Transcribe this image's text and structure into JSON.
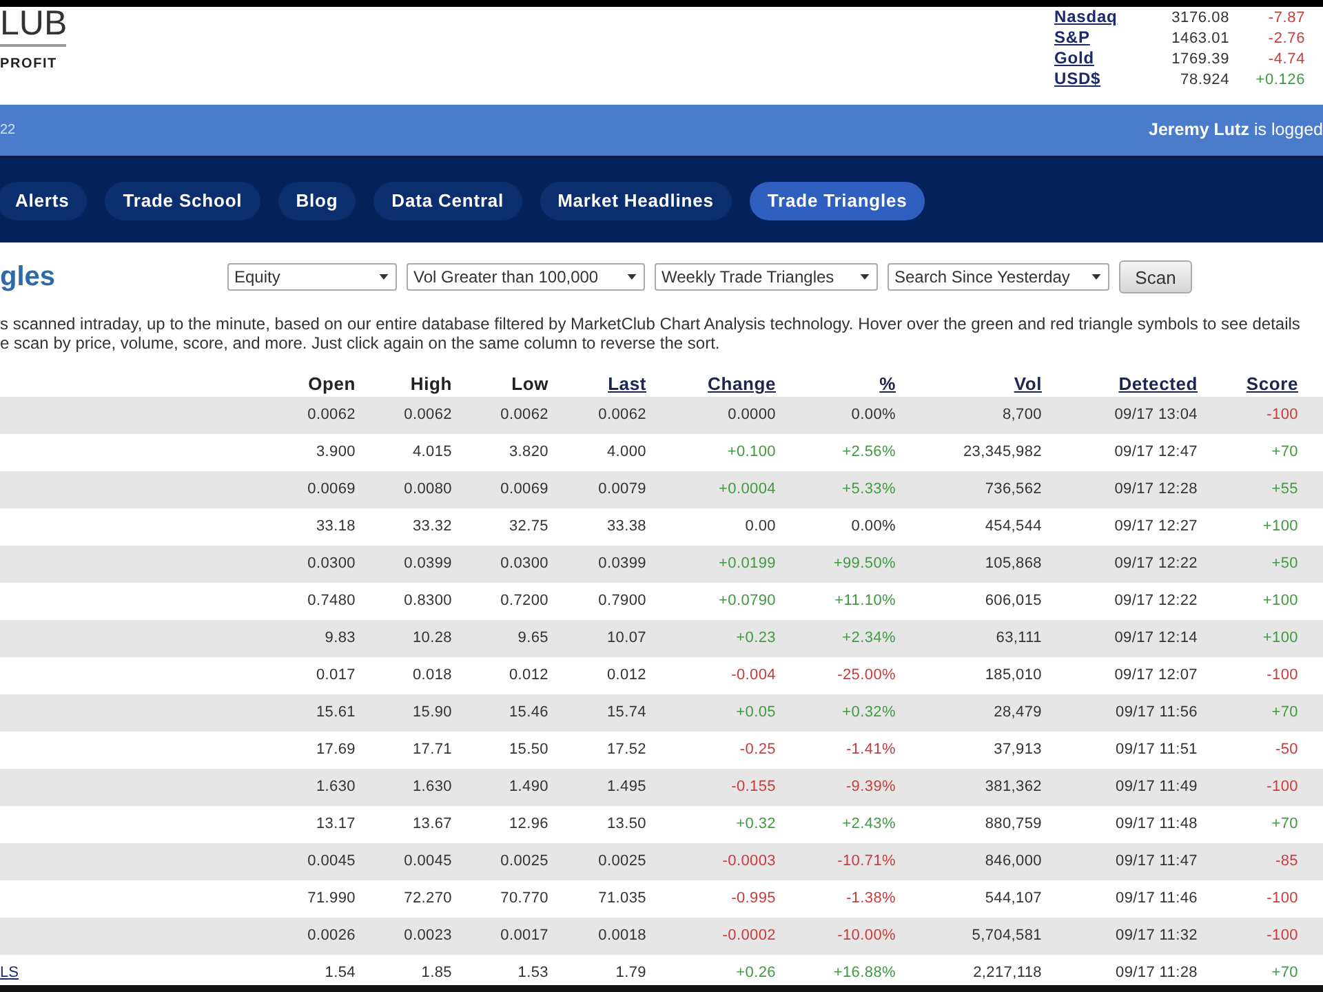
{
  "logo": {
    "wordmark": "LUB",
    "tagline": "PROFIT"
  },
  "market_ticker": [
    {
      "name": "Nasdaq",
      "value": "3176.08",
      "change": "-7.87",
      "color": "#cc3b3b"
    },
    {
      "name": "S&P",
      "value": "1463.01",
      "change": "-2.76",
      "color": "#cc3b3b"
    },
    {
      "name": "Gold",
      "value": "1769.39",
      "change": "-4.74",
      "color": "#cc3b3b"
    },
    {
      "name": "USD$",
      "value": "78.924",
      "change": "+0.126",
      "color": "#3f9b3f"
    }
  ],
  "user_bar": {
    "left_text": "22",
    "status": "**Jeremy Lutz** is logged"
  },
  "nav_tabs": [
    {
      "label": "Alerts",
      "selected": false
    },
    {
      "label": "Trade School",
      "selected": false
    },
    {
      "label": "Blog",
      "selected": false
    },
    {
      "label": "Data Central",
      "selected": false
    },
    {
      "label": "Market Headlines",
      "selected": false
    },
    {
      "label": "Trade Triangles",
      "selected": true
    }
  ],
  "page_title": "gles",
  "filters": [
    {
      "value": "Equity"
    },
    {
      "value": "Vol Greater than 100,000"
    },
    {
      "value": "Weekly Trade Triangles"
    },
    {
      "value": "Search Since Yesterday"
    }
  ],
  "scan_button": "Scan",
  "description_lines": [
    "s scanned intraday, up to the minute, based on our entire database filtered by MarketClub Chart Analysis technology. Hover over the green and red triangle symbols to see details",
    "e scan by price, volume, score, and more. Just click again on the same column to reverse the sort."
  ],
  "table": {
    "columns": [
      {
        "label": "Open",
        "sortable": false
      },
      {
        "label": "High",
        "sortable": false
      },
      {
        "label": "Low",
        "sortable": false
      },
      {
        "label": "Last",
        "sortable": true
      },
      {
        "label": "Change",
        "sortable": true
      },
      {
        "label": "%",
        "sortable": true
      },
      {
        "label": "Vol",
        "sortable": true
      },
      {
        "label": "Detected",
        "sortable": true
      },
      {
        "label": "Score",
        "sortable": true
      }
    ],
    "rows": [
      {
        "open": "0.0062",
        "high": "0.0062",
        "low": "0.0062",
        "last": "0.0062",
        "change": {
          "text": "0.0000",
          "color": "#333333"
        },
        "pct": {
          "text": "0.00%",
          "color": "#333333"
        },
        "vol": "8,700",
        "detected": "09/17 13:04",
        "score": {
          "text": "-100",
          "color": "#cc3b3b"
        }
      },
      {
        "open": "3.900",
        "high": "4.015",
        "low": "3.820",
        "last": "4.000",
        "change": {
          "text": "+0.100",
          "color": "#3f9b3f"
        },
        "pct": {
          "text": "+2.56%",
          "color": "#3f9b3f"
        },
        "vol": "23,345,982",
        "detected": "09/17 12:47",
        "score": {
          "text": "+70",
          "color": "#3f9b3f"
        }
      },
      {
        "open": "0.0069",
        "high": "0.0080",
        "low": "0.0069",
        "last": "0.0079",
        "change": {
          "text": "+0.0004",
          "color": "#3f9b3f"
        },
        "pct": {
          "text": "+5.33%",
          "color": "#3f9b3f"
        },
        "vol": "736,562",
        "detected": "09/17 12:28",
        "score": {
          "text": "+55",
          "color": "#3f9b3f"
        }
      },
      {
        "open": "33.18",
        "high": "33.32",
        "low": "32.75",
        "last": "33.38",
        "change": {
          "text": "0.00",
          "color": "#333333"
        },
        "pct": {
          "text": "0.00%",
          "color": "#333333"
        },
        "vol": "454,544",
        "detected": "09/17 12:27",
        "score": {
          "text": "+100",
          "color": "#3f9b3f"
        }
      },
      {
        "open": "0.0300",
        "high": "0.0399",
        "low": "0.0300",
        "last": "0.0399",
        "change": {
          "text": "+0.0199",
          "color": "#3f9b3f"
        },
        "pct": {
          "text": "+99.50%",
          "color": "#3f9b3f"
        },
        "vol": "105,868",
        "detected": "09/17 12:22",
        "score": {
          "text": "+50",
          "color": "#3f9b3f"
        }
      },
      {
        "open": "0.7480",
        "high": "0.8300",
        "low": "0.7200",
        "last": "0.7900",
        "change": {
          "text": "+0.0790",
          "color": "#3f9b3f"
        },
        "pct": {
          "text": "+11.10%",
          "color": "#3f9b3f"
        },
        "vol": "606,015",
        "detected": "09/17 12:22",
        "score": {
          "text": "+100",
          "color": "#3f9b3f"
        }
      },
      {
        "open": "9.83",
        "high": "10.28",
        "low": "9.65",
        "last": "10.07",
        "change": {
          "text": "+0.23",
          "color": "#3f9b3f"
        },
        "pct": {
          "text": "+2.34%",
          "color": "#3f9b3f"
        },
        "vol": "63,111",
        "detected": "09/17 12:14",
        "score": {
          "text": "+100",
          "color": "#3f9b3f"
        }
      },
      {
        "open": "0.017",
        "high": "0.018",
        "low": "0.012",
        "last": "0.012",
        "change": {
          "text": "-0.004",
          "color": "#cc3b3b"
        },
        "pct": {
          "text": "-25.00%",
          "color": "#cc3b3b"
        },
        "vol": "185,010",
        "detected": "09/17 12:07",
        "score": {
          "text": "-100",
          "color": "#cc3b3b"
        }
      },
      {
        "open": "15.61",
        "high": "15.90",
        "low": "15.46",
        "last": "15.74",
        "change": {
          "text": "+0.05",
          "color": "#3f9b3f"
        },
        "pct": {
          "text": "+0.32%",
          "color": "#3f9b3f"
        },
        "vol": "28,479",
        "detected": "09/17 11:56",
        "score": {
          "text": "+70",
          "color": "#3f9b3f"
        }
      },
      {
        "open": "17.69",
        "high": "17.71",
        "low": "15.50",
        "last": "17.52",
        "change": {
          "text": "-0.25",
          "color": "#cc3b3b"
        },
        "pct": {
          "text": "-1.41%",
          "color": "#cc3b3b"
        },
        "vol": "37,913",
        "detected": "09/17 11:51",
        "score": {
          "text": "-50",
          "color": "#cc3b3b"
        }
      },
      {
        "open": "1.630",
        "high": "1.630",
        "low": "1.490",
        "last": "1.495",
        "change": {
          "text": "-0.155",
          "color": "#cc3b3b"
        },
        "pct": {
          "text": "-9.39%",
          "color": "#cc3b3b"
        },
        "vol": "381,362",
        "detected": "09/17 11:49",
        "score": {
          "text": "-100",
          "color": "#cc3b3b"
        }
      },
      {
        "open": "13.17",
        "high": "13.67",
        "low": "12.96",
        "last": "13.50",
        "change": {
          "text": "+0.32",
          "color": "#3f9b3f"
        },
        "pct": {
          "text": "+2.43%",
          "color": "#3f9b3f"
        },
        "vol": "880,759",
        "detected": "09/17 11:48",
        "score": {
          "text": "+70",
          "color": "#3f9b3f"
        }
      },
      {
        "open": "0.0045",
        "high": "0.0045",
        "low": "0.0025",
        "last": "0.0025",
        "change": {
          "text": "-0.0003",
          "color": "#cc3b3b"
        },
        "pct": {
          "text": "-10.71%",
          "color": "#cc3b3b"
        },
        "vol": "846,000",
        "detected": "09/17 11:47",
        "score": {
          "text": "-85",
          "color": "#cc3b3b"
        }
      },
      {
        "open": "71.990",
        "high": "72.270",
        "low": "70.770",
        "last": "71.035",
        "change": {
          "text": "-0.995",
          "color": "#cc3b3b"
        },
        "pct": {
          "text": "-1.38%",
          "color": "#cc3b3b"
        },
        "vol": "544,107",
        "detected": "09/17 11:46",
        "score": {
          "text": "-100",
          "color": "#cc3b3b"
        }
      },
      {
        "open": "0.0026",
        "high": "0.0023",
        "low": "0.0017",
        "last": "0.0018",
        "change": {
          "text": "-0.0002",
          "color": "#cc3b3b"
        },
        "pct": {
          "text": "-10.00%",
          "color": "#cc3b3b"
        },
        "vol": "5,704,581",
        "detected": "09/17 11:32",
        "score": {
          "text": "-100",
          "color": "#cc3b3b"
        }
      },
      {
        "symbol": "LS",
        "open": "1.54",
        "high": "1.85",
        "low": "1.53",
        "last": "1.79",
        "change": {
          "text": "+0.26",
          "color": "#3f9b3f"
        },
        "pct": {
          "text": "+16.88%",
          "color": "#3f9b3f"
        },
        "vol": "2,217,118",
        "detected": "09/17 11:28",
        "score": {
          "text": "+70",
          "color": "#3f9b3f"
        }
      }
    ]
  }
}
